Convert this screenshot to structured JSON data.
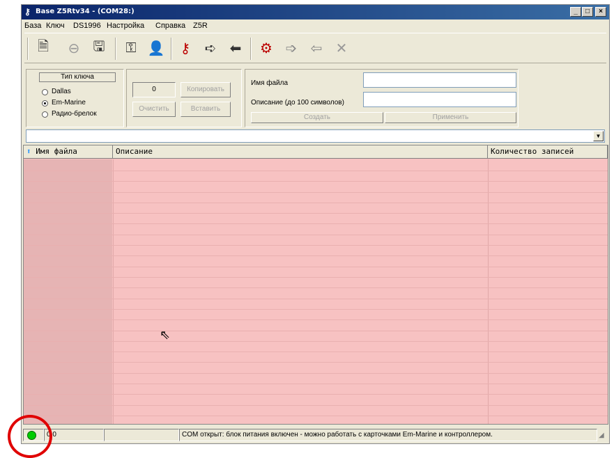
{
  "window": {
    "title": "Base Z5Rtv34 - (COM28:)"
  },
  "menu": [
    "База",
    "Ключ",
    "DS1996",
    "Настройка",
    "Справка",
    "Z5R"
  ],
  "toolbar_icons": [
    "new-document-icon",
    "back-icon",
    "save-icon",
    "key-add-icon",
    "user-icon",
    "key-ds1996-icon",
    "key-write-icon",
    "key-read-icon",
    "z5r-controller-icon",
    "arrow-right-key-icon",
    "arrow-left-key-icon",
    "close-x-icon"
  ],
  "key_type": {
    "title": "Тип ключа",
    "options": [
      "Dallas",
      "Em-Marine",
      "Радио-брелок"
    ],
    "selected": 1
  },
  "buffer": {
    "count": "0",
    "copy": "Копировать",
    "clear": "Очистить",
    "paste": "Вставить"
  },
  "file": {
    "name_label": "Имя файла",
    "desc_label": "Описание (до 100 символов)",
    "name_value": "",
    "desc_value": "",
    "create": "Создать",
    "apply": "Применить"
  },
  "grid": {
    "columns": [
      "Имя файла",
      "Описание",
      "Количество записей"
    ]
  },
  "status": {
    "code": "0:0",
    "message": "COM открыт: блок питания включен - можно работать с карточками Em-Marine и контроллером."
  },
  "colors": {
    "grid_bg": "#f7c2c2",
    "indicator": "#00cc00",
    "highlight_circle": "#e00000"
  }
}
